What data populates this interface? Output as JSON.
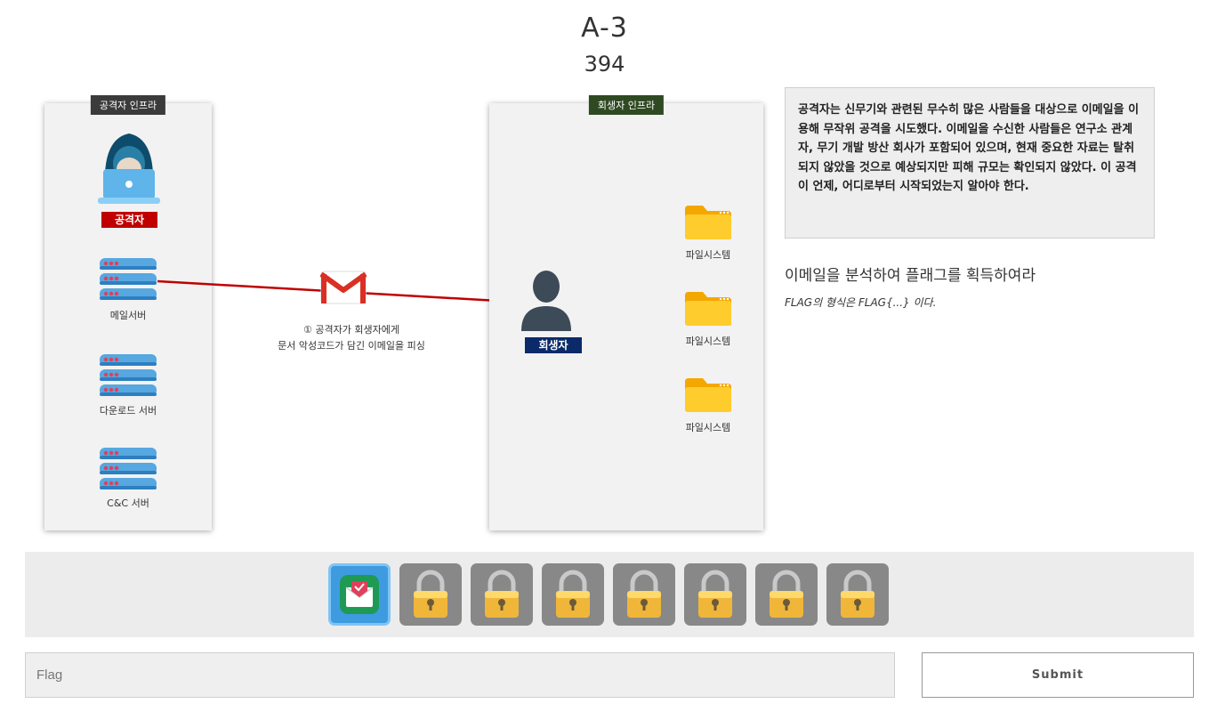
{
  "challenge": {
    "title": "A-3",
    "score": "394"
  },
  "diagram": {
    "attacker_infra_label": "공격자 인프라",
    "victim_infra_label": "회생자 인프라",
    "attacker_label": "공격자",
    "mail_server_label": "메일서버",
    "download_server_label": "다운로드 서버",
    "cnc_server_label": "C&C 서버",
    "attack_caption_line1": "① 공격자가 회생자에게",
    "attack_caption_line2": "문서 악성코드가 담긴 이메일을 피싱",
    "victim_label": "회생자",
    "filesystem_labels": [
      "파일시스템",
      "파일시스템",
      "파일시스템"
    ],
    "colors": {
      "attacker_badge": "#c00000",
      "victim_badge": "#0a2a6a",
      "attack_arrow": "#c00000"
    }
  },
  "description": "공격자는 신무기와 관련된 무수히 많은 사람들을 대상으로 이메일을 이용해 무작위 공격을 시도했다. 이메일을 수신한 사람들은 연구소 관계자, 무기 개발 방산 회사가 포함되어 있으며, 현재 중요한 자료는 탈취되지 않았을 것으로 예상되지만 피해 규모는 확인되지 않았다. 이 공격이 언제, 어디로부터 시작되었는지 알아야 한다.",
  "instruction": "이메일을 분석하여 플래그를 획득하여라",
  "format_note": "FLAG의 형식은 FLAG{...} 이다.",
  "stages": [
    {
      "icon": "envelope-icon",
      "state": "active"
    },
    {
      "icon": "padlock-icon",
      "state": "locked"
    },
    {
      "icon": "padlock-icon",
      "state": "locked"
    },
    {
      "icon": "padlock-icon",
      "state": "locked"
    },
    {
      "icon": "padlock-icon",
      "state": "locked"
    },
    {
      "icon": "padlock-icon",
      "state": "locked"
    },
    {
      "icon": "padlock-icon",
      "state": "locked"
    },
    {
      "icon": "padlock-icon",
      "state": "locked"
    }
  ],
  "flag_form": {
    "placeholder": "Flag",
    "submit_label": "Submit"
  }
}
